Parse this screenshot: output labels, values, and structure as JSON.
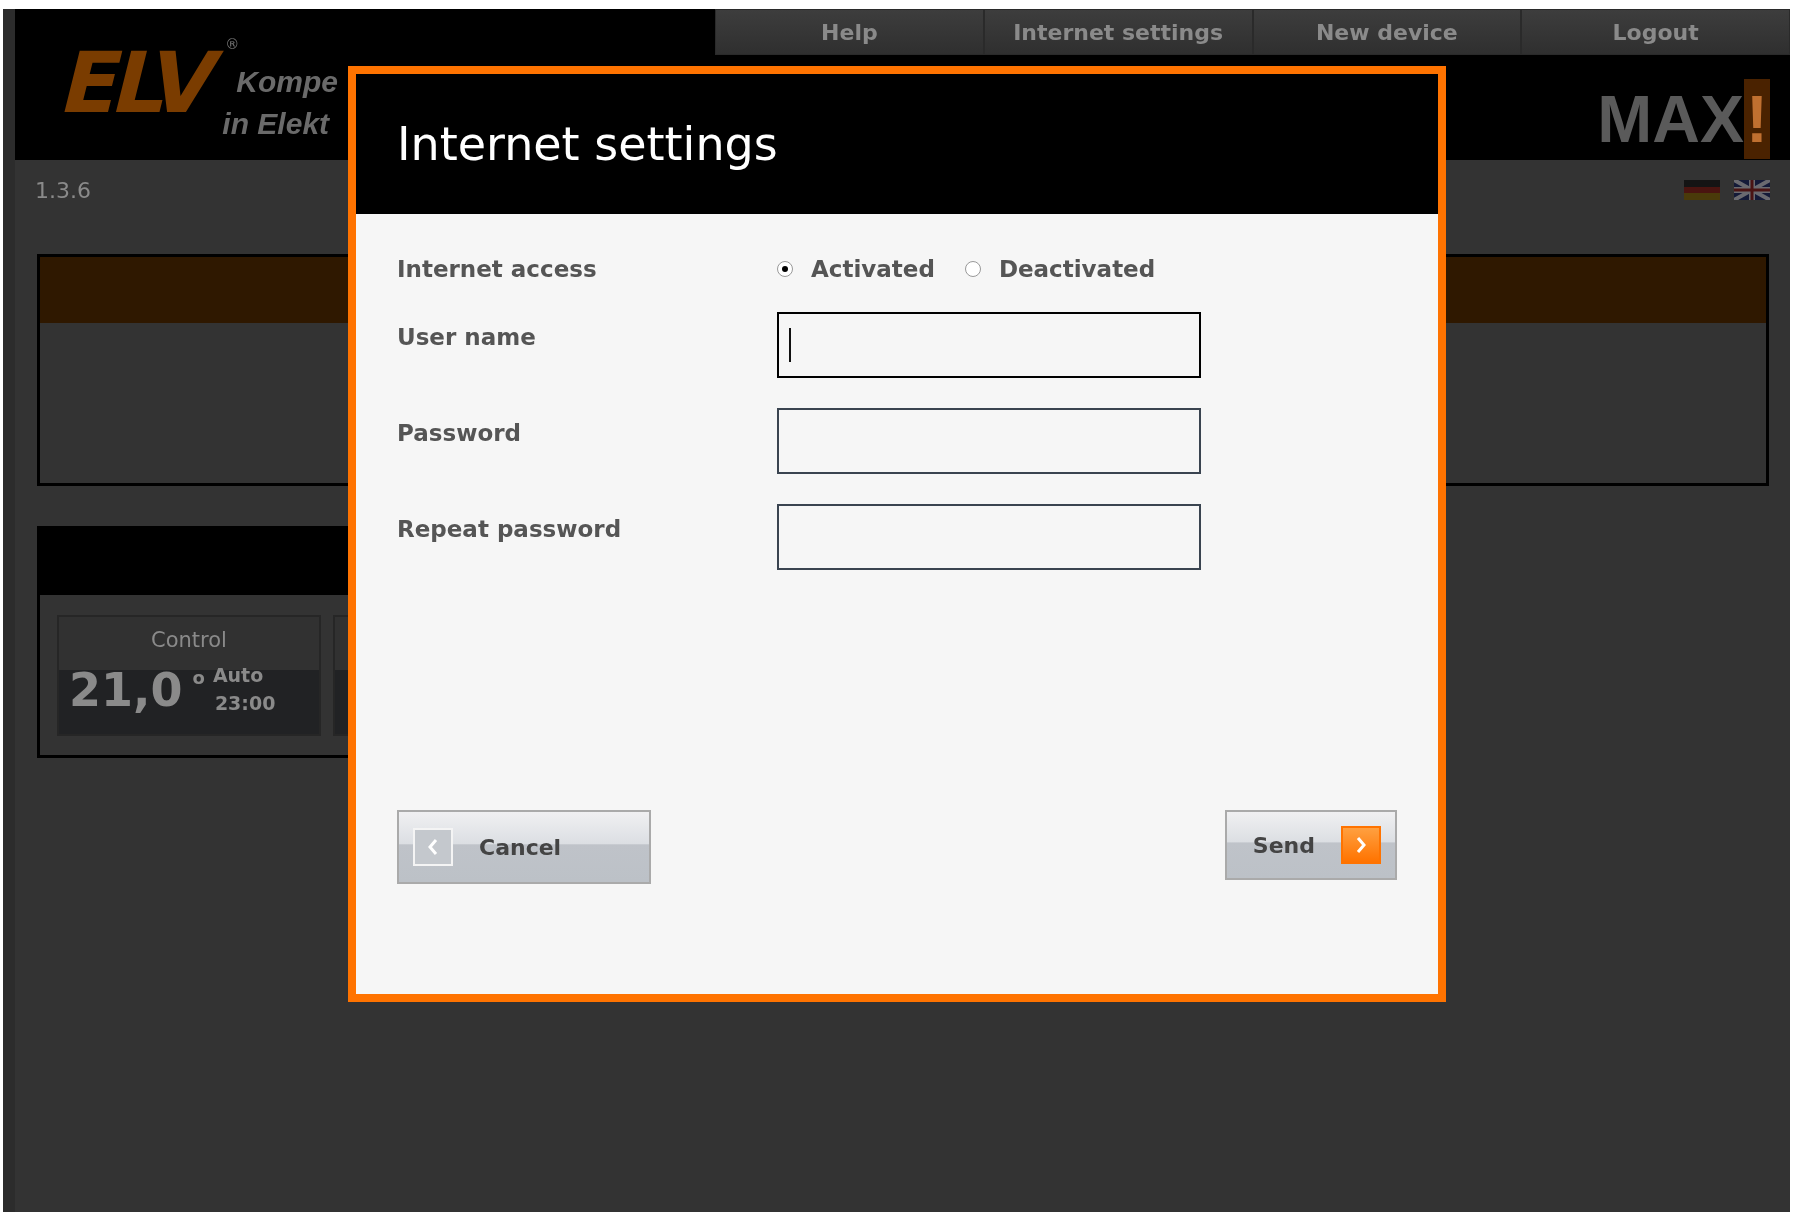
{
  "header": {
    "logo": "ELV",
    "logo_mark": "®",
    "tagline": [
      "Kompe",
      "in Elekt"
    ],
    "nav": [
      {
        "label": "Help"
      },
      {
        "label": "Internet settings"
      },
      {
        "label": "New device"
      },
      {
        "label": "Logout"
      }
    ],
    "brand": "MAX",
    "brand_mark": "!"
  },
  "version": "1.3.6",
  "languages": [
    {
      "kind": "de"
    },
    {
      "kind": "en"
    }
  ],
  "tile": {
    "title": "Control",
    "temperature": "21,0",
    "degree": "o",
    "mode": "Auto",
    "time": "23:00"
  },
  "dialog": {
    "title": "Internet settings",
    "fields": [
      {
        "kind": "radio",
        "label": "Internet access",
        "options": [
          {
            "label": "Activated",
            "selected": true
          },
          {
            "label": "Deactivated",
            "selected": false
          }
        ]
      },
      {
        "kind": "text",
        "label": "User name",
        "focused": true
      },
      {
        "kind": "password",
        "label": "Password",
        "focused": false
      },
      {
        "kind": "password",
        "label": "Repeat password",
        "focused": false
      }
    ],
    "buttons": [
      {
        "kind": "back",
        "label": "Cancel"
      },
      {
        "kind": "forward",
        "label": "Send"
      }
    ]
  }
}
